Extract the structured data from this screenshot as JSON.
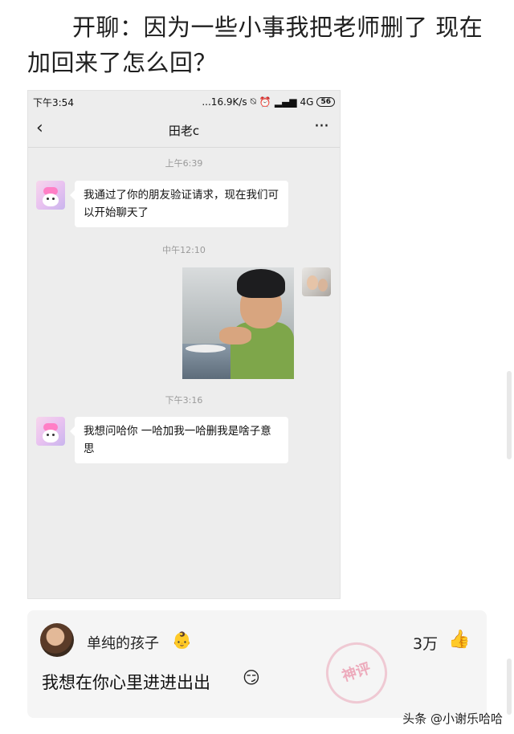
{
  "post": {
    "title": "开聊：因为一些小事我把老师删了 现在加回来了怎么回？"
  },
  "phone": {
    "status": {
      "time": "下午3:54",
      "net_speed": "...16.9K/s",
      "signal": "4G",
      "battery": "56"
    },
    "chat": {
      "contact_name": "田老c",
      "back_icon": "chevron-left-icon",
      "more_icon": "more-dots-icon",
      "messages": [
        {
          "time": "上午6:39",
          "text": "我通过了你的朋友验证请求，现在我们可以开始聊天了",
          "from": "them"
        },
        {
          "time": "中午12:10",
          "text": "",
          "from": "me",
          "type": "image"
        },
        {
          "time": "下午3:16",
          "text": "我想问哈你 一哈加我一哈删我是啥子意思",
          "from": "them"
        }
      ]
    }
  },
  "comment": {
    "username": "单纯的孩子",
    "name_emoji": "👶",
    "likes": "3万",
    "like_icon": "thumbs-up-icon",
    "text": "我想在你心里进进出出",
    "text_emoji": "😏",
    "stamp": "神评"
  },
  "watermark": "头条 @小谢乐哈哈"
}
